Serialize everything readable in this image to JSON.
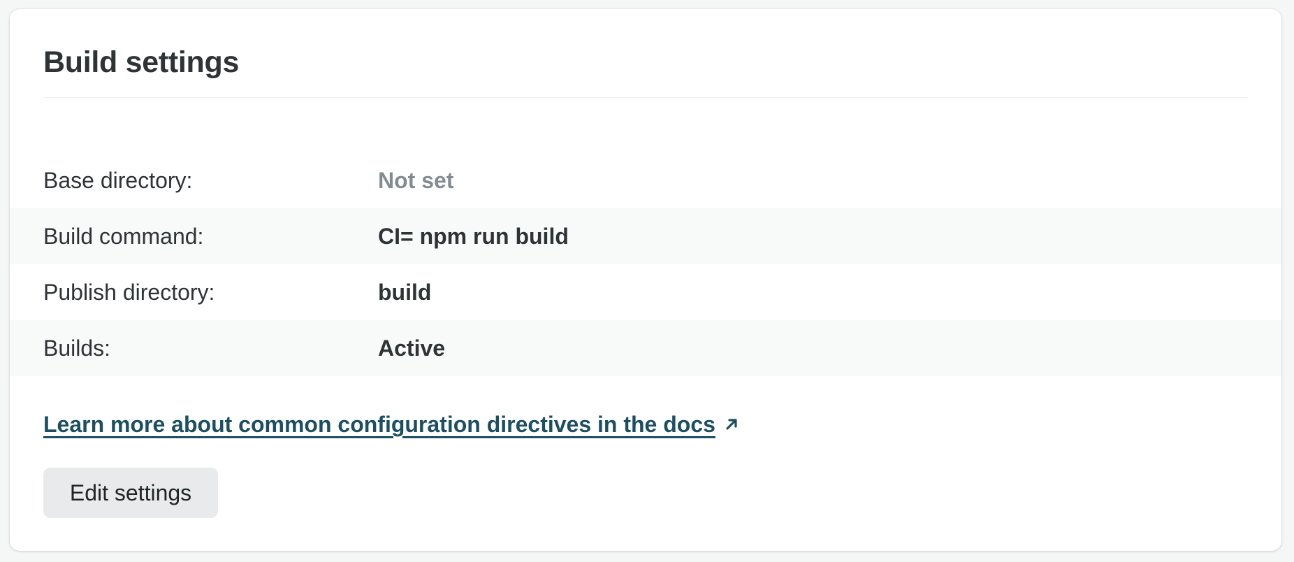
{
  "card": {
    "title": "Build settings"
  },
  "settings": [
    {
      "label": "Base directory:",
      "value": "Not set",
      "muted": true
    },
    {
      "label": "Build command:",
      "value": "CI= npm run build",
      "muted": false
    },
    {
      "label": "Publish directory:",
      "value": "build",
      "muted": false
    },
    {
      "label": "Builds:",
      "value": "Active",
      "muted": false
    }
  ],
  "docs_link": {
    "text": "Learn more about common configuration directives in the docs",
    "icon": "external-link-arrow-icon"
  },
  "actions": {
    "edit_label": "Edit settings"
  },
  "colors": {
    "text": "#2e3335",
    "muted": "#848b90",
    "link": "#1c4f61",
    "row_shade": "#f8f9f9",
    "button_bg": "#e9eaeb"
  }
}
